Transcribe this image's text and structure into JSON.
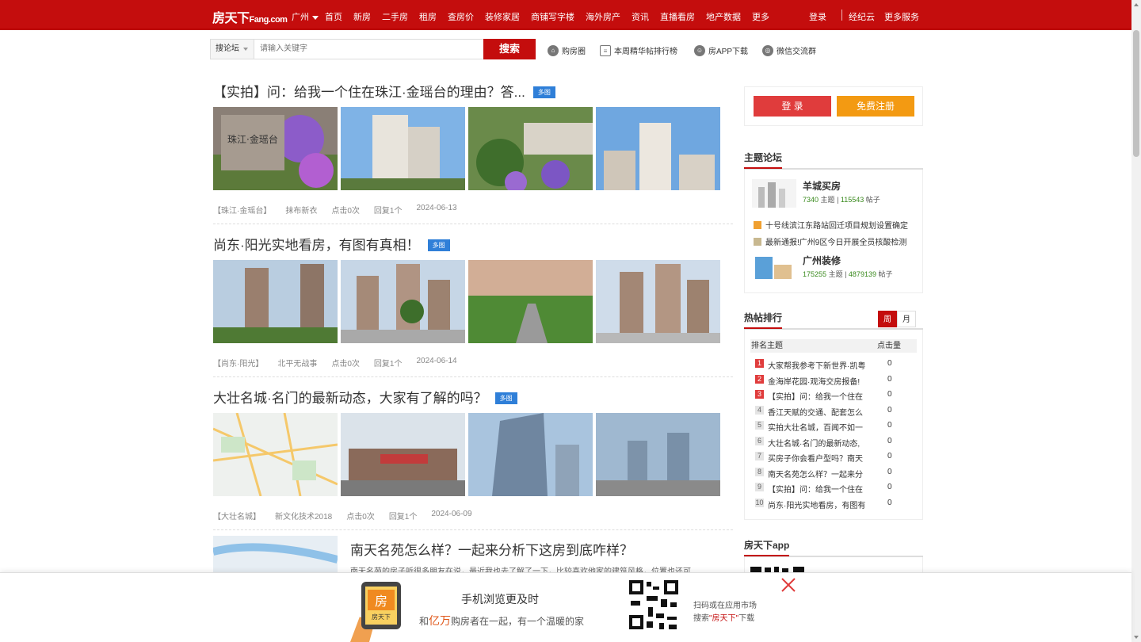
{
  "header": {
    "logo_text": "房天下",
    "logo_sub": "Fang.com",
    "city": "广州",
    "nav": [
      "首页",
      "新房",
      "二手房",
      "租房",
      "查房价",
      "装修家居",
      "商铺写字楼",
      "海外房产",
      "资讯",
      "直播看房",
      "地产数据",
      "更多"
    ],
    "login": "登录",
    "broker": "经纪云",
    "more_services": "更多服务"
  },
  "search": {
    "scope": "搜论坛",
    "placeholder": "请输入关键字",
    "button": "搜索"
  },
  "quick_links": [
    "购房圈",
    "本周精华帖排行榜",
    "房APP下载",
    "微信交流群"
  ],
  "posts": [
    {
      "title": "【实拍】问：给我一个住在珠江·金瑶台的理由？答...",
      "tag": "多图",
      "forum": "【珠江·金瑶台】",
      "author": "抹布新衣",
      "clicks": "点击0次",
      "replies": "回复1个",
      "date": "2024-06-13"
    },
    {
      "title": "尚东·阳光实地看房，有图有真相！",
      "tag": "多图",
      "forum": "【尚东·阳光】",
      "author": "北平无战事",
      "clicks": "点击0次",
      "replies": "回复1个",
      "date": "2024-06-14"
    },
    {
      "title": "大壮名城·名门的最新动态，大家有了解的吗？",
      "tag": "多图",
      "forum": "【大壮名城】",
      "author": "新文化技术2018",
      "clicks": "点击0次",
      "replies": "回复1个",
      "date": "2024-06-09"
    },
    {
      "title": "南天名苑怎么样？一起来分析下这房到底咋样？",
      "excerpt": "南天名苑的房子听很多朋友在说，最近我也去了解了一下，比较喜欢他家的建筑风格，位置也还可"
    }
  ],
  "sidebar": {
    "login": "登 录",
    "register": "免费注册",
    "forum_title": "主题论坛",
    "forums": [
      {
        "name": "羊城买房",
        "topics": "7340",
        "topics_label": "主题",
        "posts": "115543",
        "posts_label": "帖子"
      },
      {
        "name": "广州装修",
        "topics": "175255",
        "topics_label": "主题",
        "posts": "4879139",
        "posts_label": "帖子"
      }
    ],
    "forum_lines": [
      "十号线滨江东路站回迁项目规划设置确定",
      "最新通报!广州9区今日开展全员核酸检测"
    ],
    "rank_title": "热帖排行",
    "tab_week": "周",
    "tab_month": "月",
    "rank_col1": "排名主题",
    "rank_col2": "点击量",
    "ranks": [
      {
        "n": "1",
        "t": "大家帮我参考下新世界·凯粤",
        "c": "0"
      },
      {
        "n": "2",
        "t": "金海岸花园·观海交房报备!",
        "c": "0"
      },
      {
        "n": "3",
        "t": "【实拍】问：给我一个住在",
        "c": "0"
      },
      {
        "n": "4",
        "t": "香江天赋的交通、配套怎么",
        "c": "0"
      },
      {
        "n": "5",
        "t": "实拍大壮名城，百闻不如一",
        "c": "0"
      },
      {
        "n": "6",
        "t": "大壮名城·名门的最新动态,",
        "c": "0"
      },
      {
        "n": "7",
        "t": "买房子你会看户型吗？南天",
        "c": "0"
      },
      {
        "n": "8",
        "t": "南天名苑怎么样？一起来分",
        "c": "0"
      },
      {
        "n": "9",
        "t": "【实拍】问：给我一个住在",
        "c": "0"
      },
      {
        "n": "10",
        "t": "尚东·阳光实地看房，有图有",
        "c": "0"
      }
    ],
    "app_title": "房天下app"
  },
  "bottom_banner": {
    "phone_text": "房",
    "phone_sub": "房天下",
    "line1": "手机浏览更及时",
    "line2_pre": "和",
    "line2_em": "亿万",
    "line2_post": "购房者在一起，有一个温暖的家",
    "scan1": "扫码或在应用市场",
    "scan2_pre": "搜索",
    "scan2_em": "\"房天下\"",
    "scan2_post": "下载"
  },
  "colors": {
    "brand_red": "#c40d0d",
    "register_orange": "#f39a12",
    "tag_blue": "#2f7fd8",
    "stat_green": "#3a8a1e"
  }
}
